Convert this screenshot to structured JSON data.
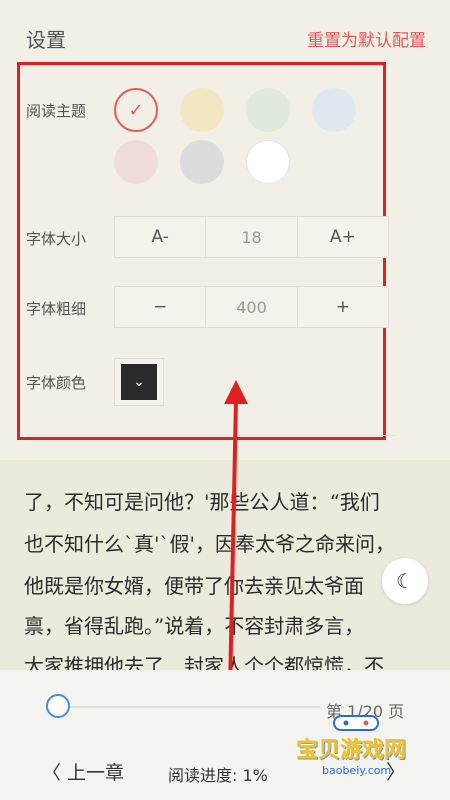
{
  "settings": {
    "title": "设置",
    "reset_label": "重置为默认配置",
    "theme_label": "阅读主题",
    "theme_colors": [
      "#ffffff00",
      "#f3e6c2",
      "#dfeadb",
      "#dde9ee",
      "#f1dcdc",
      "#dcdcdc",
      "#ffffff"
    ],
    "font_size_label": "字体大小",
    "font_size_decrease": "A-",
    "font_size_value": "18",
    "font_size_increase": "A+",
    "font_weight_label": "字体粗细",
    "font_weight_decrease": "−",
    "font_weight_value": "400",
    "font_weight_increase": "+",
    "font_color_label": "字体颜色",
    "font_color_value": "#2a2a2a",
    "check_icon": "✓",
    "chevron_icon": "⌄"
  },
  "reader": {
    "lines": [
      "了，不知可是问他？'那些公人道：“我们",
      "也不知什么`真'`假'，因奉太爷之命来问，",
      "他既是你女婿，便带了你去亲见太爷面",
      "禀，省得乱跑。”说着，不容封肃多言，",
      "大家推拥他去了．封家人个个都惊慌，不"
    ],
    "night_icon": "☾"
  },
  "footer": {
    "page_indicator": "第 1/20 页",
    "slider_progress": 0.0,
    "prev_chapter": "〈 上一章",
    "reading_progress": "阅读进度: 1%",
    "next_arrow": "〉"
  },
  "watermark": {
    "text": "宝贝游戏网",
    "url": "baobeiy.com"
  }
}
